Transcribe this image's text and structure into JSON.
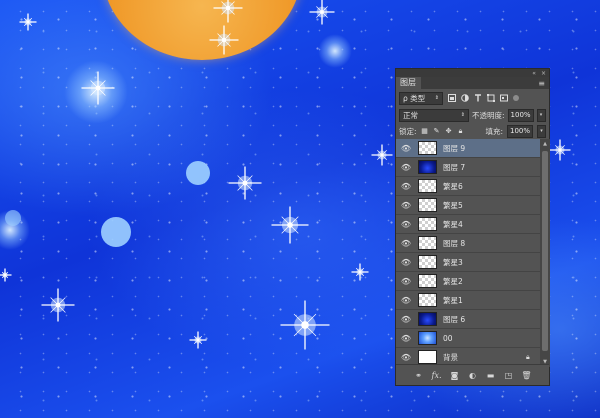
{
  "panel": {
    "tab_label": "图层",
    "menu_glyph": "≡",
    "collapse_glyph": "«",
    "close_glyph": "×",
    "filter": {
      "kind_label": "ρ 类型",
      "icons": [
        "image-filter-icon",
        "adjustment-filter-icon",
        "type-filter-icon",
        "shape-filter-icon",
        "smart-object-filter-icon"
      ]
    },
    "blend_mode": "正常",
    "opacity_label": "不透明度:",
    "opacity_value": "100%",
    "lock_label": "锁定:",
    "fill_label": "填充:",
    "fill_value": "100%",
    "layers": [
      {
        "name": "图层 9",
        "thumb": "checker",
        "visible": true,
        "active": true
      },
      {
        "name": "图层 7",
        "thumb": "navy",
        "visible": true
      },
      {
        "name": "繁星6",
        "thumb": "checker",
        "visible": true
      },
      {
        "name": "繁星5",
        "thumb": "checker",
        "visible": true
      },
      {
        "name": "繁星4",
        "thumb": "checker",
        "visible": true
      },
      {
        "name": "图层 8",
        "thumb": "checker",
        "visible": true
      },
      {
        "name": "繁星3",
        "thumb": "checker",
        "visible": true
      },
      {
        "name": "繁星2",
        "thumb": "checker",
        "visible": true
      },
      {
        "name": "繁星1",
        "thumb": "checker",
        "visible": true
      },
      {
        "name": "图层 6",
        "thumb": "navy",
        "visible": true
      },
      {
        "name": "00",
        "thumb": "pic",
        "visible": true
      },
      {
        "name": "背景",
        "thumb": "white",
        "visible": true,
        "locked": true
      }
    ],
    "footer_icons": [
      "link-layers-icon",
      "fx-icon",
      "add-mask-icon",
      "adjustment-layer-icon",
      "new-group-icon",
      "new-layer-icon",
      "delete-layer-icon"
    ],
    "footer_glyphs": {
      "fx": "fx."
    }
  },
  "colors": {
    "panel_bg": "#535353",
    "active_layer": "#5d6f88",
    "canvas_blue": "#1440e0",
    "planet": "#f09a2a"
  }
}
